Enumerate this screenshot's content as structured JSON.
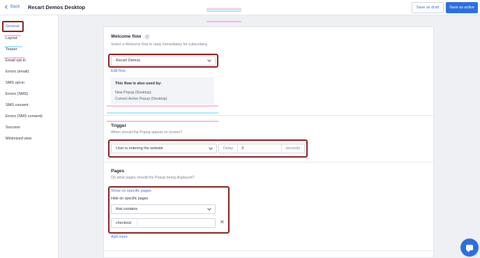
{
  "header": {
    "back_label": "Back",
    "title": "Recart Demos Desktop",
    "save_draft_label": "Save as draft",
    "save_active_label": "Save as active"
  },
  "sidebar": {
    "items": [
      {
        "label": "General"
      },
      {
        "label": "Layout"
      },
      {
        "label": "Teaser"
      },
      {
        "label": "Email opt-in"
      },
      {
        "label": "Errors (email)"
      },
      {
        "label": "SMS opt-in"
      },
      {
        "label": "Errors (SMS)"
      },
      {
        "label": "SMS consent"
      },
      {
        "label": "Errors (SMS consent)"
      },
      {
        "label": "Success"
      },
      {
        "label": "Minimized view"
      }
    ]
  },
  "welcome_flow": {
    "title": "Welcome flow",
    "info_icon": "info-icon",
    "subtitle": "Select a Welcome flow to reply immediately for subscribing",
    "selected": "Recart Demos",
    "edit_link": "Edit flow",
    "used_by_title": "This flow is also used by:",
    "used_by": [
      "New Popup (Desktop)",
      "Current Active Popup (Desktop)"
    ]
  },
  "trigger": {
    "title": "Trigger",
    "subtitle": "When should the Popup appear on screen?",
    "selected": "User is entering the website",
    "delay_label": "Delay",
    "delay_value": "3",
    "delay_unit": "seconds"
  },
  "pages": {
    "title": "Pages",
    "subtitle": "On what pages should the Popup being displayed?",
    "show_link": "Show on specific pages",
    "hide_label": "Hide on specific pages",
    "condition": "that contains",
    "value": "checkout",
    "add_more": "Add more"
  },
  "colors": {
    "accent": "#2d6fe0",
    "highlight_box": "#8b1a1a"
  }
}
